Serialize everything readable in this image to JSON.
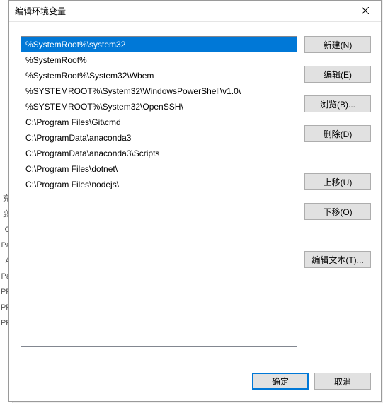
{
  "dialog": {
    "title": "编辑环境变量"
  },
  "list": {
    "items": [
      "%SystemRoot%\\system32",
      "%SystemRoot%",
      "%SystemRoot%\\System32\\Wbem",
      "%SYSTEMROOT%\\System32\\WindowsPowerShell\\v1.0\\",
      "%SYSTEMROOT%\\System32\\OpenSSH\\",
      "C:\\Program Files\\Git\\cmd",
      "C:\\ProgramData\\anaconda3",
      "C:\\ProgramData\\anaconda3\\Scripts",
      "C:\\Program Files\\dotnet\\",
      "C:\\Program Files\\nodejs\\"
    ],
    "selected_index": 0
  },
  "buttons": {
    "new": "新建(N)",
    "edit": "编辑(E)",
    "browse": "浏览(B)...",
    "delete": "删除(D)",
    "move_up": "上移(U)",
    "move_down": "下移(O)",
    "edit_text": "编辑文本(T)...",
    "ok": "确定",
    "cancel": "取消"
  },
  "bg_fragments": [
    "充",
    "变",
    "O",
    "Pa",
    "A",
    "Pa",
    "PF",
    "PF",
    "PF"
  ]
}
